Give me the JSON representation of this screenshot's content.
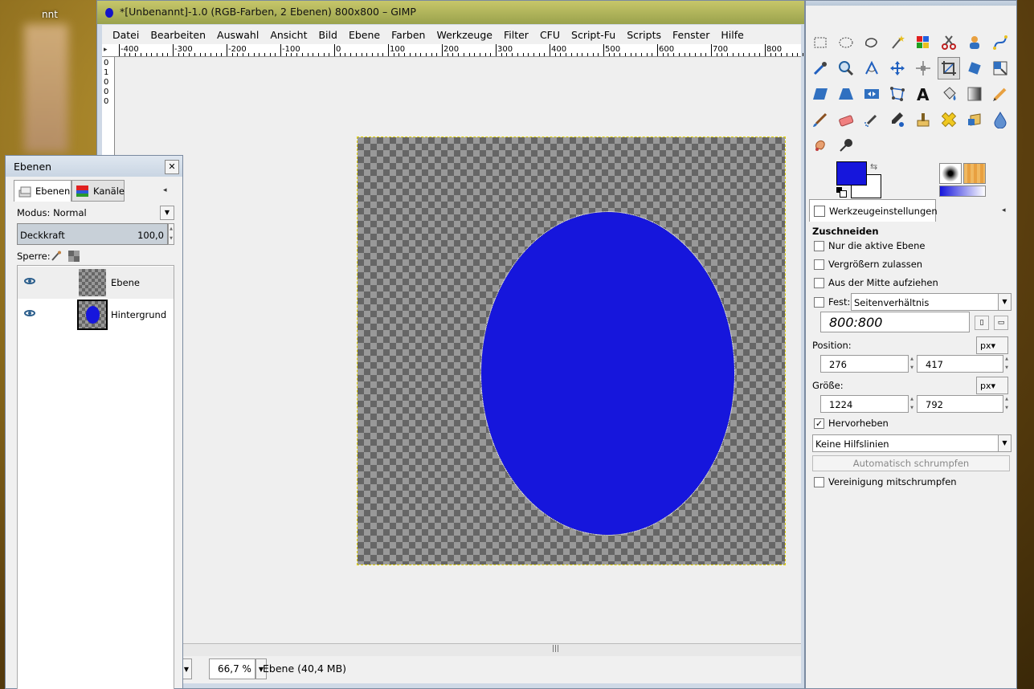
{
  "desktop": {
    "partial_label": "nnt"
  },
  "image_window": {
    "title": "*[Unbenannt]-1.0 (RGB-Farben, 2 Ebenen) 800x800 – GIMP",
    "menu": [
      "Datei",
      "Bearbeiten",
      "Auswahl",
      "Ansicht",
      "Bild",
      "Ebene",
      "Farben",
      "Werkzeuge",
      "Filter",
      "CFU",
      "Script-Fu",
      "Scripts",
      "Fenster",
      "Hilfe"
    ],
    "ruler_top_labels": [
      "-400",
      "-300",
      "-200",
      "-100",
      "0",
      "100",
      "200",
      "300",
      "400",
      "500",
      "600",
      "700",
      "800"
    ],
    "ruler_left_labels": [
      "0",
      "1",
      "0",
      "0",
      "0"
    ],
    "zoom": "66,7 %",
    "status": "Ebene (40,4 MB)"
  },
  "layers_dock": {
    "title": "Ebenen",
    "tabs": [
      "Ebenen",
      "Kanäle"
    ],
    "mode_label": "Modus:",
    "mode_value": "Normal",
    "opacity_label": "Deckkraft",
    "opacity_value": "100,0",
    "lock_label": "Sperre:",
    "layers": [
      {
        "name": "Ebene",
        "visible": true,
        "selected": true
      },
      {
        "name": "Hintergrund",
        "visible": true,
        "selected": false
      }
    ]
  },
  "toolbox": {
    "colors": {
      "foreground": "#1616dc",
      "background": "#ffffff"
    },
    "tool_icons": [
      "rect-select-icon",
      "ellipse-select-icon",
      "free-select-icon",
      "fuzzy-select-icon",
      "color-select-icon",
      "scissors-icon",
      "foreground-select-icon",
      "paths-icon",
      "color-picker-icon",
      "zoom-icon",
      "measure-icon",
      "move-icon",
      "align-icon",
      "crop-icon",
      "rotate-icon",
      "scale-icon",
      "shear-icon",
      "perspective-icon",
      "flip-icon",
      "cage-icon",
      "text-icon",
      "bucket-fill-icon",
      "blend-icon",
      "pencil-icon",
      "paintbrush-icon",
      "eraser-icon",
      "airbrush-icon",
      "ink-icon",
      "clone-icon",
      "heal-icon",
      "perspective-clone-icon",
      "blur-icon",
      "smudge-icon",
      "dodge-burn-icon"
    ],
    "active_tool_index": 13,
    "options_tab": "Werkzeugeinstellungen",
    "tool_name": "Zuschneiden",
    "opt_only_active_layer": "Nur die aktive Ebene",
    "opt_allow_growing": "Vergrößern zulassen",
    "opt_expand_center": "Aus der Mitte aufziehen",
    "opt_fixed": "Fest:",
    "fixed_mode": "Seitenverhältnis",
    "aspect_value": "800:800",
    "position_label": "Position:",
    "position_unit": "px",
    "position_x": "276",
    "position_y": "417",
    "size_label": "Größe:",
    "size_unit": "px",
    "size_w": "1224",
    "size_h": "792",
    "highlight_label": "Hervorheben",
    "highlight_checked": true,
    "guides_value": "Keine Hilfslinien",
    "auto_shrink_label": "Automatisch schrumpfen",
    "shrink_merged_label": "Vereinigung mitschrumpfen"
  }
}
